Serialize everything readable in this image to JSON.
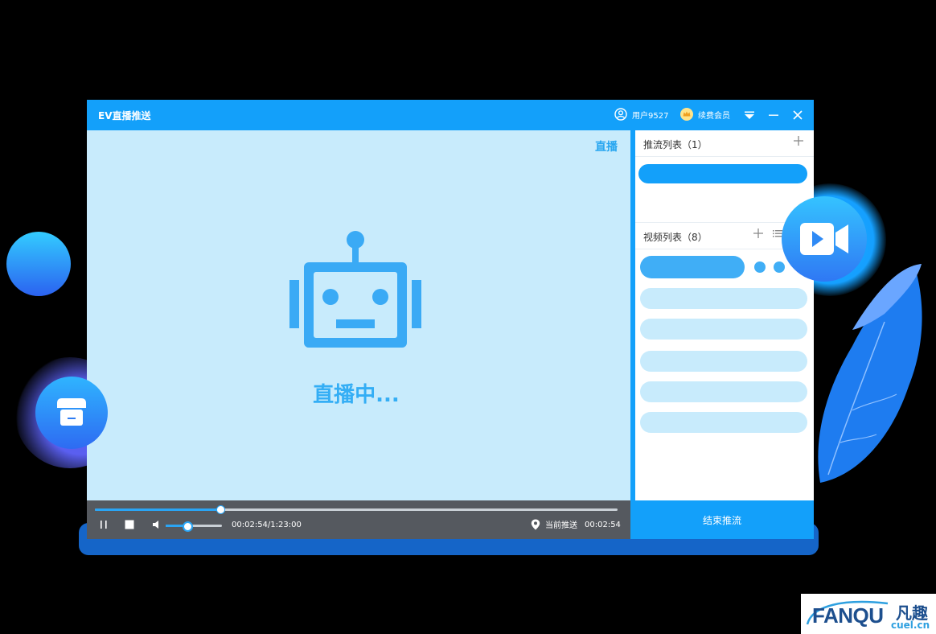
{
  "app": {
    "title": "EV直播推送",
    "user_label": "用户9527",
    "vip_label": "续费会员"
  },
  "player": {
    "live_tag": "直播",
    "status_text": "直播中...",
    "progress_percent": 24,
    "volume_percent": 38,
    "time_display": "00:02:54/1:23:00",
    "current_push_label": "当前推送",
    "current_push_time": "00:02:54"
  },
  "sidebar": {
    "stream_list_title": "推流列表（1）",
    "video_list_title": "视频列表（8）",
    "end_button_label": "结束推流"
  },
  "watermark": {
    "brand": "FANQU",
    "brand_cn": "凡趣",
    "domain": "cuel.cn"
  },
  "colors": {
    "accent": "#13a0fa",
    "player_bg": "#c8ebfc",
    "control_bar": "#55595f",
    "list_item": "#c8ebfc"
  },
  "icons": {
    "user": "user-circle-icon",
    "vip": "crown-icon",
    "dropdown": "dropdown-icon",
    "minimize": "minimize-icon",
    "close": "close-icon",
    "pause": "pause-icon",
    "stop": "stop-icon",
    "volume": "volume-icon",
    "location": "location-pin-icon",
    "add": "plus-icon",
    "list": "list-icon",
    "robot": "robot-icon",
    "video_camera": "video-camera-icon",
    "store": "store-icon"
  }
}
